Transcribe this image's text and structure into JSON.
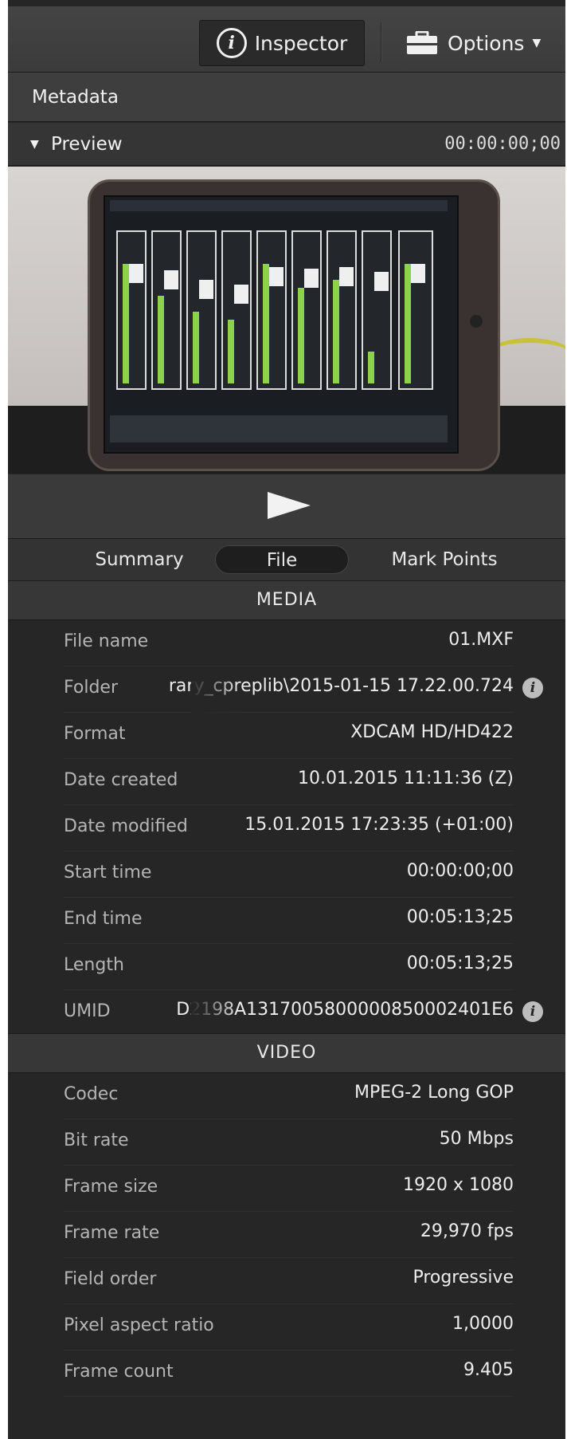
{
  "toolbar": {
    "inspector_label": "Inspector",
    "options_label": "Options"
  },
  "metadata_header": "Metadata",
  "preview": {
    "label": "Preview",
    "timecode": "00:00:00;00"
  },
  "tabs": [
    {
      "label": "Summary",
      "selected": false
    },
    {
      "label": "File",
      "selected": true
    },
    {
      "label": "Mark Points",
      "selected": false
    }
  ],
  "media": {
    "title": "MEDIA",
    "rows": [
      {
        "key": "File name",
        "value": "01.MXF"
      },
      {
        "key": "Folder",
        "value": "rary_cpreplib\\2015-01-15 17.22.00.724"
      },
      {
        "key": "Format",
        "value": "XDCAM HD/HD422"
      },
      {
        "key": "Date created",
        "value": "10.01.2015 11:11:36 (Z)"
      },
      {
        "key": "Date modified",
        "value": "15.01.2015 17:23:35 (+01:00)"
      },
      {
        "key": "Start time",
        "value": "00:00:00;00"
      },
      {
        "key": "End time",
        "value": "00:05:13;25"
      },
      {
        "key": "Length",
        "value": "00:05:13;25"
      },
      {
        "key": "UMID",
        "value": "D2198A1317005800000850002401E6"
      }
    ]
  },
  "video": {
    "title": "VIDEO",
    "rows": [
      {
        "key": "Codec",
        "value": "MPEG-2 Long GOP"
      },
      {
        "key": "Bit rate",
        "value": "50 Mbps"
      },
      {
        "key": "Frame size",
        "value": "1920 x 1080"
      },
      {
        "key": "Frame rate",
        "value": "29,970 fps"
      },
      {
        "key": "Field order",
        "value": "Progressive"
      },
      {
        "key": "Pixel aspect ratio",
        "value": "1,0000"
      },
      {
        "key": "Frame count",
        "value": "9.405"
      }
    ]
  }
}
